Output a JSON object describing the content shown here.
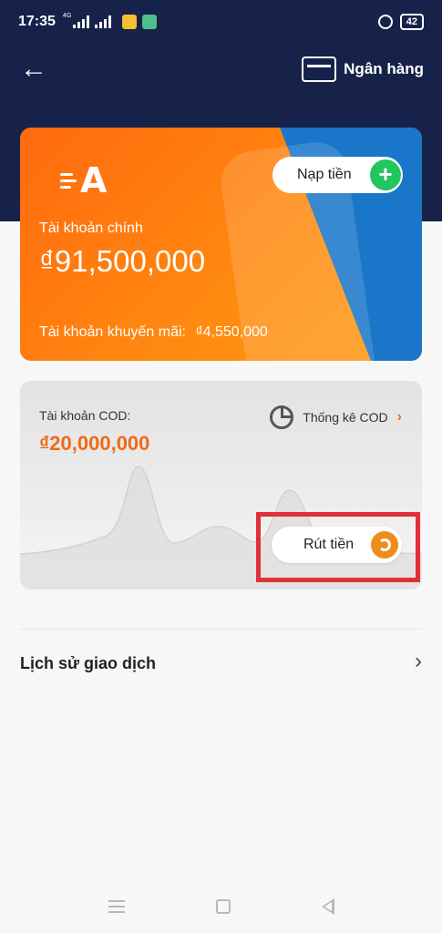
{
  "status_bar": {
    "time": "17:35",
    "network_tag": "4G",
    "battery": "42"
  },
  "header": {
    "bank_label": "Ngân hàng"
  },
  "main_card": {
    "deposit_label": "Nạp tiền",
    "main_account_label": "Tài khoản chính",
    "main_account_amount": "₫91,500,000",
    "promo_label": "Tài khoản khuyến mãi:",
    "promo_amount": "₫4,550,000"
  },
  "cod_card": {
    "label": "Tài khoản COD:",
    "amount": "₫20,000,000",
    "stats_label": "Thống kê COD",
    "withdraw_label": "Rút tiền"
  },
  "history": {
    "label": "Lịch sử giao dịch"
  },
  "colors": {
    "header_bg": "#17224a",
    "accent_orange": "#ee6a17",
    "accent_blue": "#1976c9",
    "accent_green": "#22c55e",
    "highlight_red": "#e0303a"
  },
  "icons": {
    "back": "arrow-left-icon",
    "bank": "credit-card-icon",
    "deposit": "plus-icon",
    "stats": "pie-chart-icon",
    "withdraw": "refresh-icon",
    "history": "chevron-right-icon"
  }
}
